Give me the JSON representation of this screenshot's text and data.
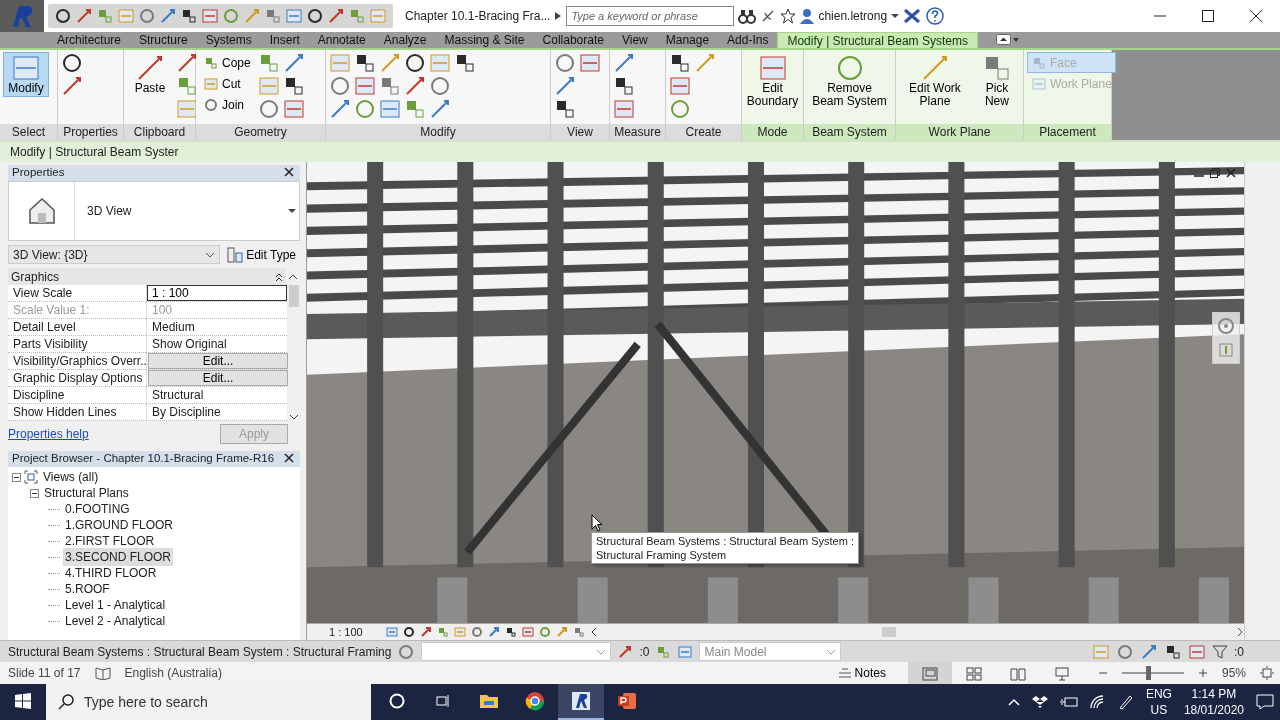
{
  "title_bar": {
    "title": "Chapter 10.1-Bracing Fra...",
    "search": {
      "placeholder": "Type a keyword or phrase"
    },
    "user": "chien.letrong"
  },
  "ribbon_tabs": [
    {
      "label": "Architecture",
      "selected": false,
      "contextual": false
    },
    {
      "label": "Structure",
      "selected": false,
      "contextual": false
    },
    {
      "label": "Systems",
      "selected": false,
      "contextual": false
    },
    {
      "label": "Insert",
      "selected": false,
      "contextual": false
    },
    {
      "label": "Annotate",
      "selected": false,
      "contextual": false
    },
    {
      "label": "Analyze",
      "selected": false,
      "contextual": false
    },
    {
      "label": "Massing & Site",
      "selected": false,
      "contextual": false
    },
    {
      "label": "Collaborate",
      "selected": false,
      "contextual": false
    },
    {
      "label": "View",
      "selected": false,
      "contextual": false
    },
    {
      "label": "Manage",
      "selected": false,
      "contextual": false
    },
    {
      "label": "Add-Ins",
      "selected": false,
      "contextual": false
    },
    {
      "label": "Modify | Structural Beam Systems",
      "selected": true,
      "contextual": true
    }
  ],
  "ribbon_panels": [
    {
      "title": "Select",
      "contextual": false,
      "buttons": [
        {
          "kind": "large",
          "label": "Modify",
          "selected": true,
          "disabled": false
        }
      ]
    },
    {
      "title": "Properties",
      "contextual": false
    },
    {
      "title": "Clipboard",
      "contextual": false,
      "buttons": [
        {
          "kind": "large",
          "label": "Paste",
          "selected": false,
          "disabled": false
        }
      ]
    },
    {
      "title": "Geometry",
      "contextual": false,
      "buttons": [
        {
          "kind": "small",
          "label": "Cope",
          "selected": false,
          "disabled": false
        },
        {
          "kind": "small",
          "label": "Cut",
          "selected": false,
          "disabled": false
        },
        {
          "kind": "small",
          "label": "Join",
          "selected": false,
          "disabled": false
        }
      ]
    },
    {
      "title": "Modify",
      "contextual": false
    },
    {
      "title": "View",
      "contextual": false
    },
    {
      "title": "Measure",
      "contextual": false
    },
    {
      "title": "Create",
      "contextual": false
    },
    {
      "title": "Mode",
      "contextual": true,
      "buttons": [
        {
          "kind": "large",
          "label": "Edit Boundary",
          "selected": false,
          "disabled": false
        }
      ]
    },
    {
      "title": "Beam System",
      "contextual": true,
      "buttons": [
        {
          "kind": "large",
          "label": "Remove Beam System",
          "selected": false,
          "disabled": false
        }
      ]
    },
    {
      "title": "Work Plane",
      "contextual": true,
      "buttons": [
        {
          "kind": "large",
          "label": "Edit Work Plane",
          "selected": false,
          "disabled": false
        },
        {
          "kind": "large",
          "label": "Pick New",
          "selected": false,
          "disabled": false
        }
      ]
    },
    {
      "title": "Placement",
      "contextual": true,
      "buttons": [
        {
          "kind": "small",
          "label": "Face",
          "selected": true,
          "disabled": true
        },
        {
          "kind": "small",
          "label": "Work Plane",
          "selected": false,
          "disabled": true
        }
      ]
    }
  ],
  "options_bar": {
    "text": "Modify | Structural Beam Syster"
  },
  "properties": {
    "title": "Properties",
    "type_name": "3D View",
    "instance": "3D View: {3D}",
    "edit_type": "Edit Type",
    "group": "Graphics",
    "rows": [
      {
        "name": "View Scale",
        "value": "1 : 100",
        "kind": "input",
        "disabled": false
      },
      {
        "name": "Scale Value    1:",
        "value": "100",
        "kind": "text",
        "disabled": true
      },
      {
        "name": "Detail Level",
        "value": "Medium",
        "kind": "text",
        "disabled": false
      },
      {
        "name": "Parts Visibility",
        "value": "Show Original",
        "kind": "text",
        "disabled": false
      },
      {
        "name": "Visibility/Graphics Overr...",
        "value": "Edit...",
        "kind": "button",
        "disabled": false
      },
      {
        "name": "Graphic Display Options",
        "value": "Edit...",
        "kind": "button",
        "disabled": false
      },
      {
        "name": "Discipline",
        "value": "Structural",
        "kind": "text",
        "disabled": false
      },
      {
        "name": "Show Hidden Lines",
        "value": "By Discipline",
        "kind": "text",
        "disabled": false
      }
    ],
    "help_link": "Properties help",
    "apply": {
      "label": "Apply",
      "disabled": true
    }
  },
  "project_browser": {
    "title": "Project Browser - Chapter 10.1-Bracing Frame-R16",
    "tree": [
      {
        "label": "Views (all)",
        "expanded": true,
        "selected": false,
        "children": [
          {
            "label": "Structural Plans",
            "expanded": true,
            "selected": false,
            "children": [
              {
                "label": "0.FOOTING",
                "selected": false
              },
              {
                "label": "1.GROUND FLOOR",
                "selected": false
              },
              {
                "label": "2.FIRST FLOOR",
                "selected": false
              },
              {
                "label": "3.SECOND FLOOR",
                "selected": true
              },
              {
                "label": "4.THIRD FLOOR",
                "selected": false
              },
              {
                "label": "5.ROOF",
                "selected": false
              },
              {
                "label": "Level 1 - Analytical",
                "selected": false
              },
              {
                "label": "Level 2 - Analytical",
                "selected": false
              }
            ]
          }
        ]
      }
    ]
  },
  "viewport": {
    "tooltip": [
      "Structural Beam Systems : Structural Beam System :",
      "Structural Framing System"
    ],
    "scale": "1 : 100"
  },
  "status_bar": {
    "text": "Structural Beam Systems : Structural Beam System : Structural Framing",
    "editable_count": ":0",
    "model": "Main Model",
    "filter_count": ":0"
  },
  "presentation_status": {
    "slide": "Slide 11 of 17",
    "language": "English (Australia)",
    "notes": "Notes",
    "views": [
      {
        "selected": true
      },
      {
        "selected": false
      },
      {
        "selected": false
      },
      {
        "selected": false
      }
    ],
    "zoom": {
      "level": 0.42,
      "reading": "95%"
    }
  },
  "taskbar": {
    "search_placeholder": "Type here to search",
    "apps": [
      {
        "selected": false
      },
      {
        "selected": false
      },
      {
        "selected": true
      },
      {
        "selected": false
      }
    ],
    "language": [
      "ENG",
      "US"
    ],
    "time": "1:14 PM",
    "date": "18/01/2020"
  }
}
